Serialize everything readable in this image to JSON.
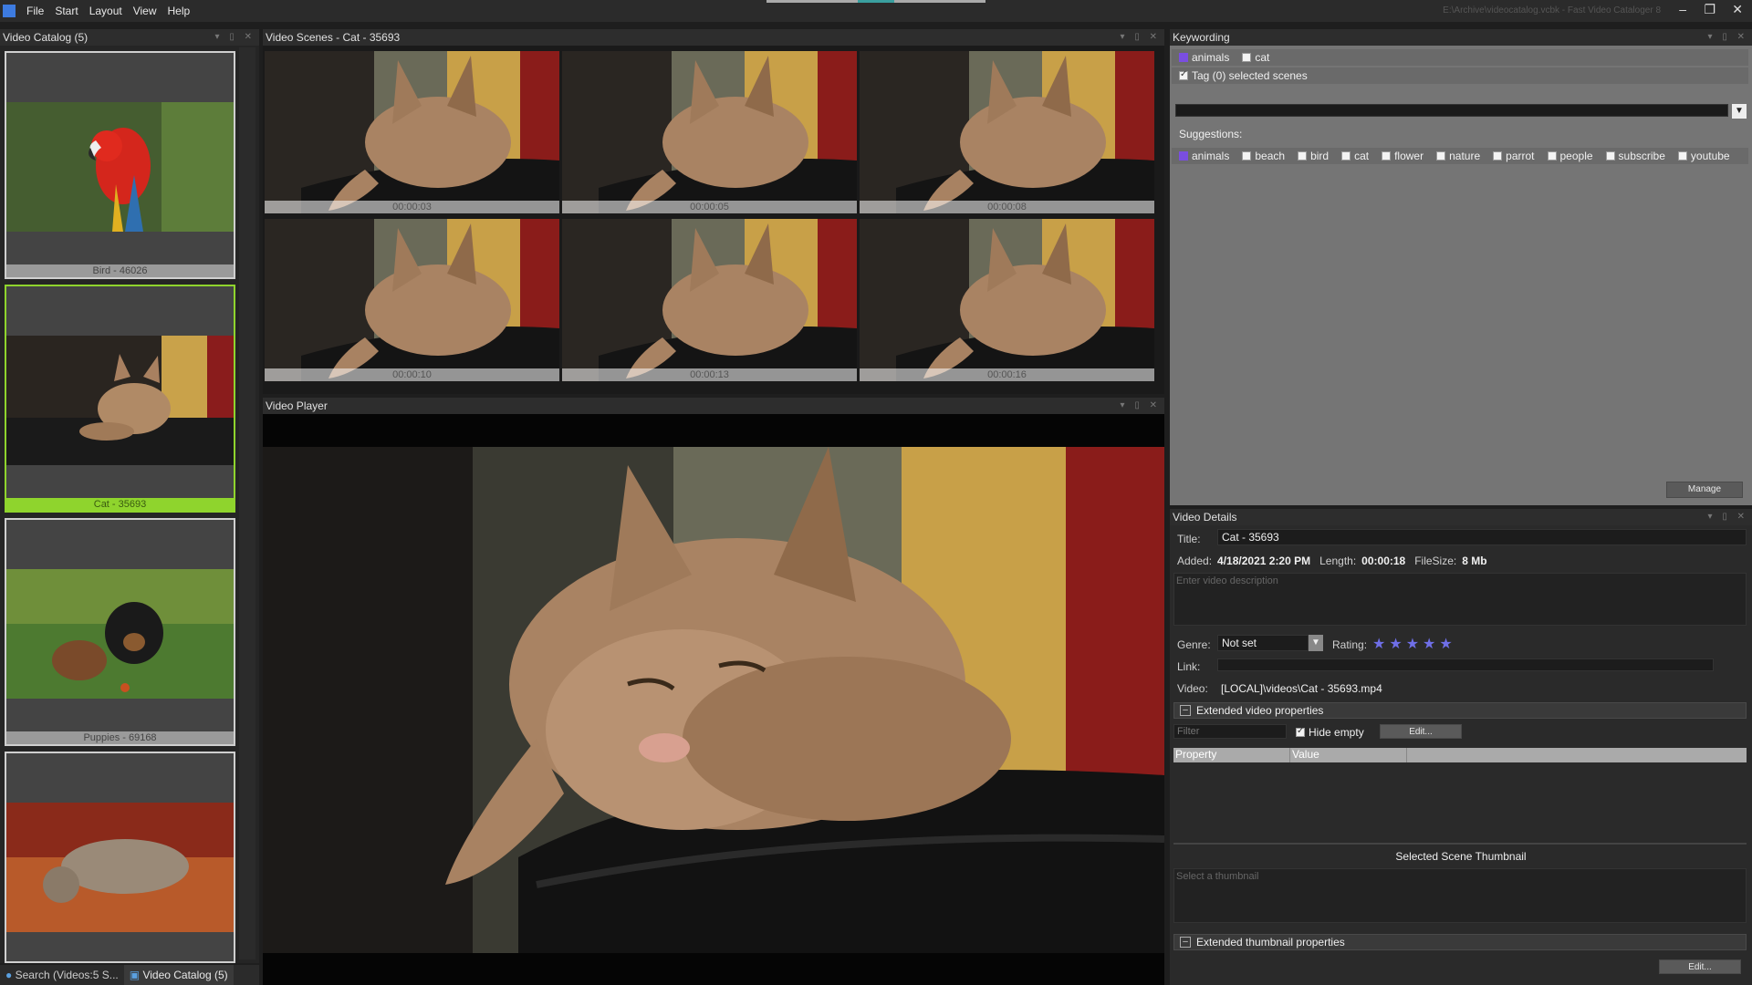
{
  "menu": {
    "items": [
      "File",
      "Start",
      "Layout",
      "View",
      "Help"
    ],
    "window_title": "E:\\Archive\\videocatalog.vcbk - Fast Video Cataloger 8"
  },
  "catalog": {
    "title": "Video Catalog (5)",
    "items": [
      {
        "caption": "Bird - 46026"
      },
      {
        "caption": "Cat - 35693"
      },
      {
        "caption": "Puppies - 69168"
      },
      {
        "caption": ""
      }
    ]
  },
  "bottom_tabs": {
    "search": "Search (Videos:5 S...",
    "catalog": "Video Catalog (5)"
  },
  "scenes": {
    "title": "Video Scenes - Cat - 35693",
    "timestamps": [
      "00:00:03",
      "00:00:05",
      "00:00:08",
      "00:00:10",
      "00:00:13",
      "00:00:16"
    ]
  },
  "player": {
    "title": "Video Player"
  },
  "keywording": {
    "title": "Keywording",
    "current_tags": [
      "animals",
      "cat"
    ],
    "tag_selected_label": "Tag (0) selected scenes",
    "suggestions_label": "Suggestions:",
    "suggestions": [
      "animals",
      "beach",
      "bird",
      "cat",
      "flower",
      "nature",
      "parrot",
      "people",
      "subscribe",
      "youtube"
    ],
    "manage_label": "Manage"
  },
  "details": {
    "title": "Video Details",
    "title_label": "Title:",
    "title_value": "Cat - 35693",
    "added_label": "Added:",
    "added_value": "4/18/2021 2:20 PM",
    "length_label": "Length:",
    "length_value": "00:00:18",
    "filesize_label": "FileSize:",
    "filesize_value": "8 Mb",
    "description_placeholder": "Enter video description",
    "genre_label": "Genre:",
    "genre_value": "Not set",
    "rating_label": "Rating:",
    "rating": 5,
    "link_label": "Link:",
    "video_label": "Video:",
    "video_value": "[LOCAL]\\videos\\Cat - 35693.mp4",
    "ext_video_props": "Extended video properties",
    "filter_placeholder": "Filter",
    "hide_empty_label": "Hide empty",
    "edit_label": "Edit...",
    "col_property": "Property",
    "col_value": "Value",
    "scene_thumb_title": "Selected Scene Thumbnail",
    "select_thumb_placeholder": "Select a thumbnail",
    "ext_thumb_props": "Extended thumbnail properties",
    "edit2_label": "Edit..."
  }
}
